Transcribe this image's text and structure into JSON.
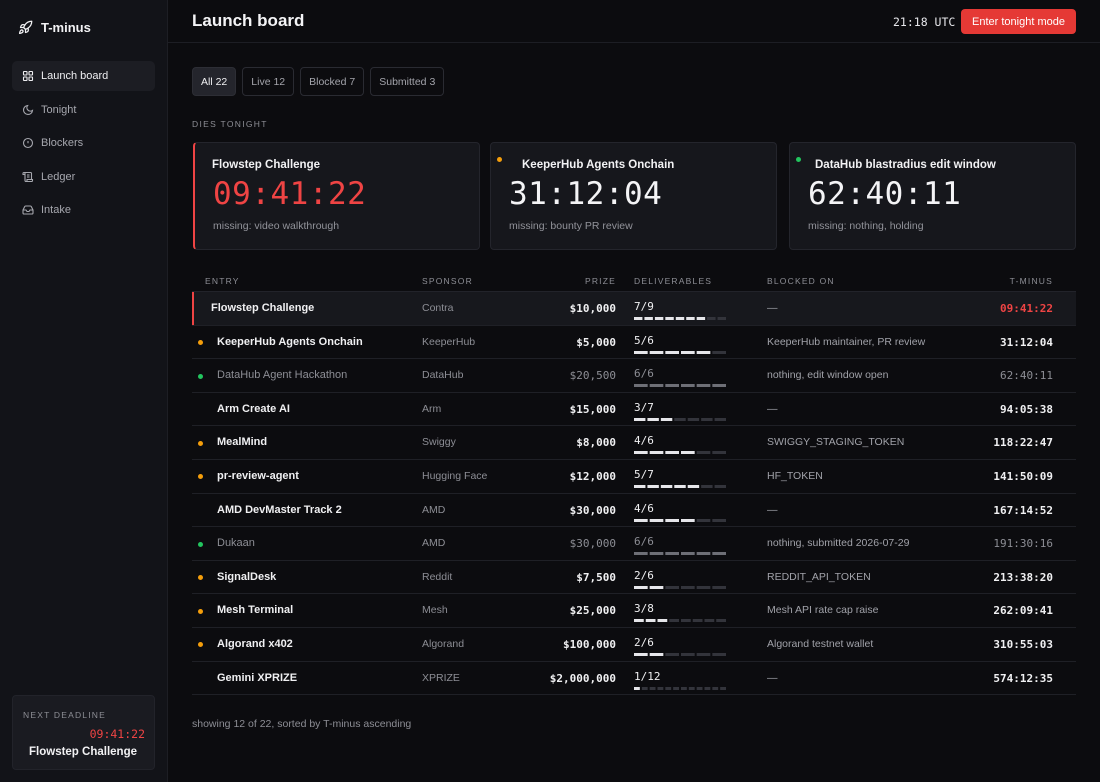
{
  "app": {
    "name": "T-minus"
  },
  "sidebar": {
    "items": [
      {
        "label": "Launch board",
        "icon": "grid-icon",
        "active": true
      },
      {
        "label": "Tonight",
        "icon": "moon-icon",
        "active": false
      },
      {
        "label": "Blockers",
        "icon": "alert-circle-icon",
        "active": false
      },
      {
        "label": "Ledger",
        "icon": "scroll-icon",
        "active": false
      },
      {
        "label": "Intake",
        "icon": "inbox-icon",
        "active": false
      }
    ],
    "next_deadline": {
      "label": "NEXT DEADLINE",
      "time": "09:41:22",
      "name": "Flowstep Challenge"
    }
  },
  "header": {
    "title": "Launch board",
    "clock": "21:18 UTC",
    "action_label": "Enter tonight mode"
  },
  "tabs": [
    {
      "label": "All 22",
      "active": true
    },
    {
      "label": "Live 12",
      "active": false
    },
    {
      "label": "Blocked 7",
      "active": false
    },
    {
      "label": "Submitted 3",
      "active": false
    }
  ],
  "dies_tonight": {
    "label": "DIES TONIGHT",
    "cards": [
      {
        "title": "Flowstep Challenge",
        "time": "09:41:22",
        "missing": "missing: video walkthrough",
        "status": "urgent"
      },
      {
        "title": "KeeperHub Agents Onchain",
        "time": "31:12:04",
        "missing": "missing: bounty PR review",
        "status": "blocked"
      },
      {
        "title": "DataHub blastradius edit window",
        "time": "62:40:11",
        "missing": "missing: nothing, holding",
        "status": "ok"
      }
    ]
  },
  "table": {
    "headers": {
      "entry": "ENTRY",
      "sponsor": "SPONSOR",
      "prize": "PRIZE",
      "deliverables": "DELIVERABLES",
      "blocked_on": "BLOCKED ON",
      "tminus": "T-MINUS"
    },
    "rows": [
      {
        "entry": "Flowstep Challenge",
        "sponsor": "Contra",
        "prize": "$10,000",
        "done": 7,
        "total": 9,
        "blocked_on": "—",
        "tminus": "09:41:22",
        "status": "urgent"
      },
      {
        "entry": "KeeperHub Agents Onchain",
        "sponsor": "KeeperHub",
        "prize": "$5,000",
        "done": 5,
        "total": 6,
        "blocked_on": "KeeperHub maintainer, PR review",
        "tminus": "31:12:04",
        "status": "blocked"
      },
      {
        "entry": "DataHub Agent Hackathon",
        "sponsor": "DataHub",
        "prize": "$20,500",
        "done": 6,
        "total": 6,
        "blocked_on": "nothing, edit window open",
        "tminus": "62:40:11",
        "status": "done"
      },
      {
        "entry": "Arm Create AI",
        "sponsor": "Arm",
        "prize": "$15,000",
        "done": 3,
        "total": 7,
        "blocked_on": "—",
        "tminus": "94:05:38",
        "status": "none"
      },
      {
        "entry": "MealMind",
        "sponsor": "Swiggy",
        "prize": "$8,000",
        "done": 4,
        "total": 6,
        "blocked_on": "SWIGGY_STAGING_TOKEN",
        "tminus": "118:22:47",
        "status": "blocked"
      },
      {
        "entry": "pr-review-agent",
        "sponsor": "Hugging Face",
        "prize": "$12,000",
        "done": 5,
        "total": 7,
        "blocked_on": "HF_TOKEN",
        "tminus": "141:50:09",
        "status": "blocked"
      },
      {
        "entry": "AMD DevMaster Track 2",
        "sponsor": "AMD",
        "prize": "$30,000",
        "done": 4,
        "total": 6,
        "blocked_on": "—",
        "tminus": "167:14:52",
        "status": "none"
      },
      {
        "entry": "Dukaan",
        "sponsor": "AMD",
        "prize": "$30,000",
        "done": 6,
        "total": 6,
        "blocked_on": "nothing, submitted 2026-07-29",
        "tminus": "191:30:16",
        "status": "done"
      },
      {
        "entry": "SignalDesk",
        "sponsor": "Reddit",
        "prize": "$7,500",
        "done": 2,
        "total": 6,
        "blocked_on": "REDDIT_API_TOKEN",
        "tminus": "213:38:20",
        "status": "blocked"
      },
      {
        "entry": "Mesh Terminal",
        "sponsor": "Mesh",
        "prize": "$25,000",
        "done": 3,
        "total": 8,
        "blocked_on": "Mesh API rate cap raise",
        "tminus": "262:09:41",
        "status": "blocked"
      },
      {
        "entry": "Algorand x402",
        "sponsor": "Algorand",
        "prize": "$100,000",
        "done": 2,
        "total": 6,
        "blocked_on": "Algorand testnet wallet",
        "tminus": "310:55:03",
        "status": "blocked"
      },
      {
        "entry": "Gemini XPRIZE",
        "sponsor": "XPRIZE",
        "prize": "$2,000,000",
        "done": 1,
        "total": 12,
        "blocked_on": "—",
        "tminus": "574:12:35",
        "status": "none"
      }
    ]
  },
  "footnote": "showing 12 of 22, sorted by T-minus ascending",
  "colors": {
    "urgent": "#ef4444",
    "blocked": "#f59e0b",
    "ok": "#22c55e",
    "accent_button": "#e53935"
  }
}
